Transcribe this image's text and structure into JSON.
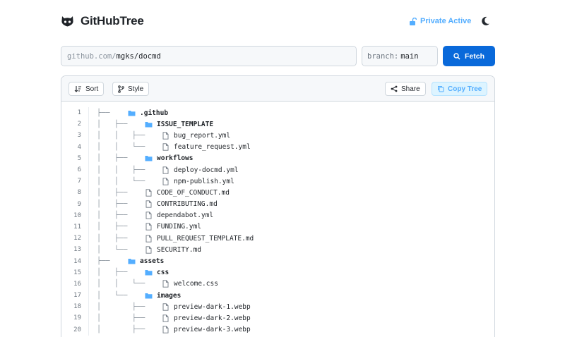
{
  "header": {
    "title": "GitHubTree",
    "private_label": "Private Active"
  },
  "inputs": {
    "url_prefix": "github.com/",
    "url_value": "mgks/docmd",
    "branch_label": "branch:",
    "branch_value": "main",
    "fetch_label": "Fetch"
  },
  "toolbar": {
    "sort_label": "Sort",
    "style_label": "Style",
    "share_label": "Share",
    "copy_label": "Copy Tree"
  },
  "colors": {
    "accent": "#0969da",
    "folder": "#54aeff",
    "private": "#54aeff"
  },
  "tree": [
    {
      "n": "1",
      "prefix": "├──",
      "name": ".github",
      "type": "dir",
      "depth": 0
    },
    {
      "n": "2",
      "prefix": "│   ├──",
      "name": "ISSUE_TEMPLATE",
      "type": "dir",
      "depth": 1
    },
    {
      "n": "3",
      "prefix": "│   │   ├──",
      "name": "bug_report.yml",
      "type": "file",
      "depth": 2
    },
    {
      "n": "4",
      "prefix": "│   │   └──",
      "name": "feature_request.yml",
      "type": "file",
      "depth": 2
    },
    {
      "n": "5",
      "prefix": "│   ├──",
      "name": "workflows",
      "type": "dir",
      "depth": 1
    },
    {
      "n": "6",
      "prefix": "│   │   ├──",
      "name": "deploy-docmd.yml",
      "type": "file",
      "depth": 2
    },
    {
      "n": "7",
      "prefix": "│   │   └──",
      "name": "npm-publish.yml",
      "type": "file",
      "depth": 2
    },
    {
      "n": "8",
      "prefix": "│   ├──",
      "name": "CODE_OF_CONDUCT.md",
      "type": "file",
      "depth": 1
    },
    {
      "n": "9",
      "prefix": "│   ├──",
      "name": "CONTRIBUTING.md",
      "type": "file",
      "depth": 1
    },
    {
      "n": "10",
      "prefix": "│   ├──",
      "name": "dependabot.yml",
      "type": "file",
      "depth": 1
    },
    {
      "n": "11",
      "prefix": "│   ├──",
      "name": "FUNDING.yml",
      "type": "file",
      "depth": 1
    },
    {
      "n": "12",
      "prefix": "│   ├──",
      "name": "PULL_REQUEST_TEMPLATE.md",
      "type": "file",
      "depth": 1
    },
    {
      "n": "13",
      "prefix": "│   └──",
      "name": "SECURITY.md",
      "type": "file",
      "depth": 1
    },
    {
      "n": "14",
      "prefix": "├──",
      "name": "assets",
      "type": "dir",
      "depth": 0
    },
    {
      "n": "15",
      "prefix": "│   ├──",
      "name": "css",
      "type": "dir",
      "depth": 1
    },
    {
      "n": "16",
      "prefix": "│   │   └──",
      "name": "welcome.css",
      "type": "file",
      "depth": 2
    },
    {
      "n": "17",
      "prefix": "│   └──",
      "name": "images",
      "type": "dir",
      "depth": 1
    },
    {
      "n": "18",
      "prefix": "│       ├──",
      "name": "preview-dark-1.webp",
      "type": "file",
      "depth": 2
    },
    {
      "n": "19",
      "prefix": "│       ├──",
      "name": "preview-dark-2.webp",
      "type": "file",
      "depth": 2
    },
    {
      "n": "20",
      "prefix": "│       ├──",
      "name": "preview-dark-3.webp",
      "type": "file",
      "depth": 2
    }
  ]
}
